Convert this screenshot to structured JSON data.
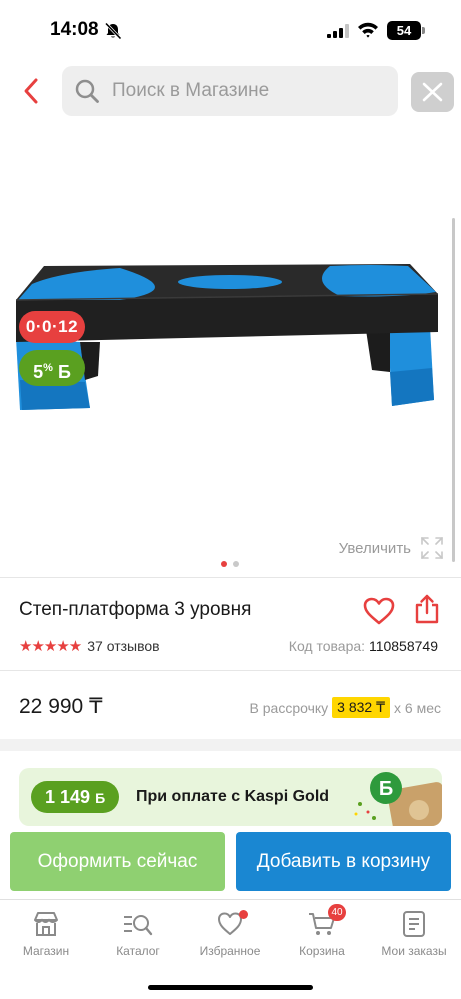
{
  "status_bar": {
    "time": "14:08",
    "battery": "54"
  },
  "header": {
    "search_placeholder": "Поиск в Магазине"
  },
  "image": {
    "installment_badge": "0·0·12",
    "bonus_badge_value": "5",
    "bonus_badge_pct": "%",
    "bonus_badge_currency": "Б",
    "zoom_label": "Увеличить",
    "slides_count": 2,
    "active_slide": 1
  },
  "product": {
    "title": "Степ-платформа 3 уровня",
    "stars": "★★★★★",
    "reviews": "37 отзывов",
    "code_label": "Код товара:",
    "code_value": "110858749"
  },
  "price": {
    "value": "22 990 ₸",
    "installment_prefix": "В рассрочку",
    "installment_amount": "3 832 ₸",
    "installment_suffix": "х 6 мес"
  },
  "gold_banner": {
    "bonus_amount": "1 149",
    "bonus_currency": "Б",
    "text": "При оплате с Kaspi Gold"
  },
  "actions": {
    "checkout": "Оформить сейчас",
    "add_to_cart": "Добавить в корзину"
  },
  "bottom_nav": {
    "items": [
      {
        "label": "Магазин",
        "icon": "shop-icon"
      },
      {
        "label": "Каталог",
        "icon": "catalog-icon"
      },
      {
        "label": "Избранное",
        "icon": "heart-icon"
      },
      {
        "label": "Корзина",
        "icon": "cart-icon",
        "badge": "40"
      },
      {
        "label": "Мои заказы",
        "icon": "orders-icon"
      }
    ]
  },
  "colors": {
    "brand_red": "#e7403f",
    "bonus_green": "#5aa020",
    "checkout_green": "#8fd071",
    "cart_blue": "#1a87d2",
    "installment_yellow": "#ffd600"
  }
}
